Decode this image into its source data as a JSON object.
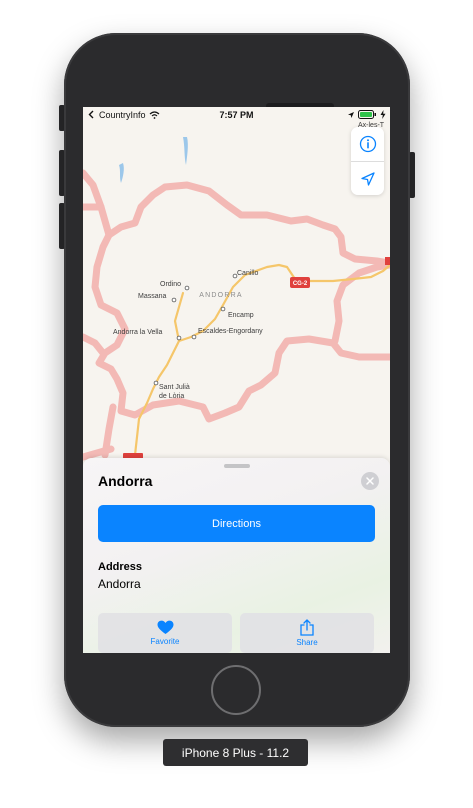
{
  "statusbar": {
    "carrier": "CountryInfo",
    "time": "7:57 PM"
  },
  "map": {
    "country_label": "ANDORRA",
    "places": {
      "canillo": "Canillo",
      "ordino": "Ordino",
      "massana": "Massana",
      "encamp": "Encamp",
      "andorra_la_vella": "Andorra la Vella",
      "escaldes": "Escaldes-Engordany",
      "sant_julia_line1": "Sant Julià",
      "sant_julia_line2": "de Lòria",
      "edge_town": "Ax-les-T"
    },
    "road_shield": "CG-2",
    "colors": {
      "border": "#f3b9b5",
      "road": "#f5c66a",
      "water": "#9cc7ea",
      "land": "#f7f4ef"
    }
  },
  "sheet": {
    "title": "Andorra",
    "directions_label": "Directions",
    "address_label": "Address",
    "address_value": "Andorra",
    "favorite_label": "Favorite",
    "share_label": "Share"
  },
  "icons": {
    "info": "info-icon",
    "location": "location-arrow-icon",
    "close": "close-icon",
    "heart": "heart-icon",
    "share": "share-icon",
    "wifi": "wifi-icon",
    "battery": "battery-icon"
  },
  "colors": {
    "accent": "#0a84ff",
    "phone_body": "#2b2b2d"
  },
  "device_label": "iPhone 8 Plus - 11.2"
}
